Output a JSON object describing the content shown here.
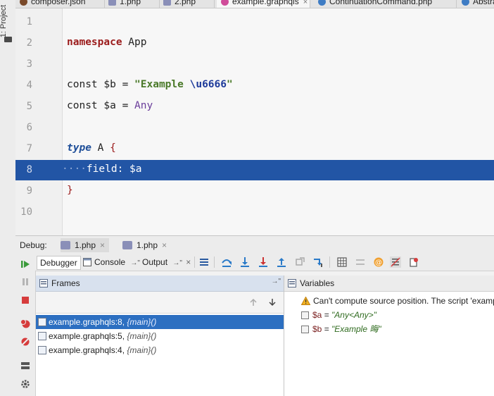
{
  "tabs": [
    {
      "label": "composer.json",
      "icon": "composer-icon"
    },
    {
      "label": "1.php",
      "icon": "php-file-icon"
    },
    {
      "label": "2.php",
      "icon": "php-file-icon"
    },
    {
      "label": "example.graphqls",
      "icon": "graphql-file-icon",
      "active": true
    },
    {
      "label": "ContinuationCommand.php",
      "icon": "class-icon"
    },
    {
      "label": "Abstra",
      "icon": "class-icon"
    }
  ],
  "project_tool": {
    "label": "1: Project"
  },
  "editor": {
    "line_numbers": [
      "1",
      "2",
      "3",
      "4",
      "5",
      "6",
      "7",
      "8",
      "9",
      "10"
    ],
    "code": {
      "l2_kw": "namespace",
      "l2_rest": " App",
      "l4_a": "const $b = ",
      "l4_str": "\"Example ",
      "l4_esc": "\\u6666",
      "l4_end": "\"",
      "l5_a": "const $a = ",
      "l5_any": "Any",
      "l7_kw": "type",
      "l7_rest": " A ",
      "l7_brace": "{",
      "l8_dots": "····",
      "l8_text": "field: $a",
      "l9_brace": "}"
    },
    "highlight_line": "8"
  },
  "debug": {
    "label": "Debug:",
    "sessions": [
      {
        "label": "1.php",
        "active": true
      },
      {
        "label": "1.php",
        "active": false
      }
    ],
    "tabs": {
      "debugger": "Debugger",
      "console": "Console",
      "console_suffix": "→\"",
      "output": "Output",
      "output_suffix": "→\""
    },
    "frames": {
      "title": "Frames",
      "title_suffix": "→\"",
      "items": [
        {
          "loc": "example.graphqls:8, ",
          "fn": "{main}()",
          "selected": true
        },
        {
          "loc": "example.graphqls:5, ",
          "fn": "{main}()",
          "selected": false
        },
        {
          "loc": "example.graphqls:4, ",
          "fn": "{main}()",
          "selected": false
        }
      ]
    },
    "variables": {
      "title": "Variables",
      "warning": "Can't compute source position. The script 'examp",
      "items": [
        {
          "name": "$a",
          "eq": " = ",
          "value": "\"Any<Any>\""
        },
        {
          "name": "$b",
          "eq": " = ",
          "value": "\"Example 晦\""
        }
      ]
    }
  },
  "colors": {
    "selection": "#2255a5",
    "keyword": "#9b1b1b",
    "string": "#4b7a2a",
    "frame_selected": "#2c6fc1"
  }
}
